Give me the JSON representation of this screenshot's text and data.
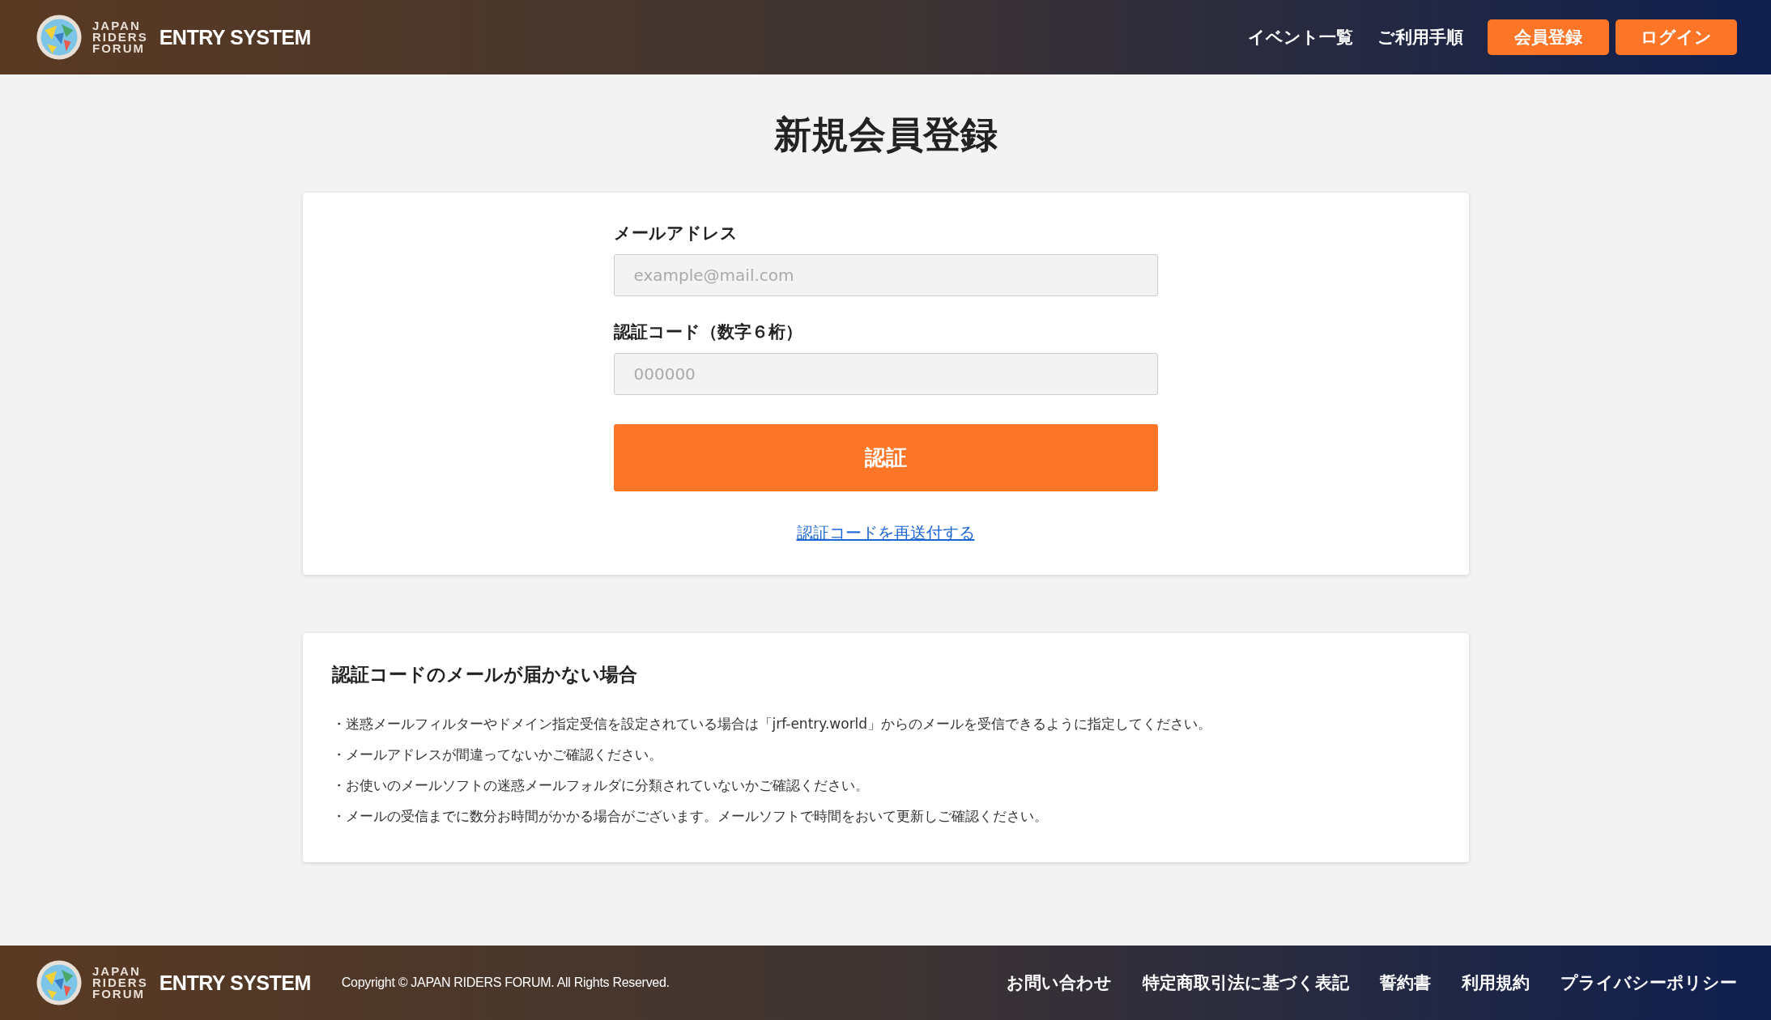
{
  "header": {
    "logo": {
      "lines": [
        "JAPAN",
        "RIDERS",
        "FORUM"
      ],
      "product": "ENTRY SYSTEM"
    },
    "nav": [
      "イベント一覧",
      "ご利用手順"
    ],
    "buttons": [
      "会員登録",
      "ログイン"
    ]
  },
  "page_title": "新規会員登録",
  "form": {
    "fields": [
      {
        "label": "メールアドレス",
        "placeholder": "example@mail.com"
      },
      {
        "label": "認証コード（数字６桁）",
        "placeholder": "000000"
      }
    ],
    "submit": "認証",
    "resend_link": "認証コードを再送付する"
  },
  "help": {
    "title": "認証コードのメールが届かない場合",
    "items": [
      "・迷惑メールフィルターやドメイン指定受信を設定されている場合は「jrf-entry.world」からのメールを受信できるように指定してください。",
      "・メールアドレスが間違ってないかご確認ください。",
      "・お使いのメールソフトの迷惑メールフォルダに分類されていないかご確認ください。",
      "・メールの受信までに数分お時間がかかる場合がございます。メールソフトで時間をおいて更新しご確認ください。"
    ]
  },
  "footer": {
    "logo": {
      "lines": [
        "JAPAN",
        "RIDERS",
        "FORUM"
      ],
      "product": "ENTRY SYSTEM"
    },
    "copyright": "Copyright © JAPAN RIDERS FORUM. All Rights Reserved.",
    "links": [
      "お問い合わせ",
      "特定商取引法に基づく表記",
      "誓約書",
      "利用規約",
      "プライバシーポリシー"
    ]
  }
}
